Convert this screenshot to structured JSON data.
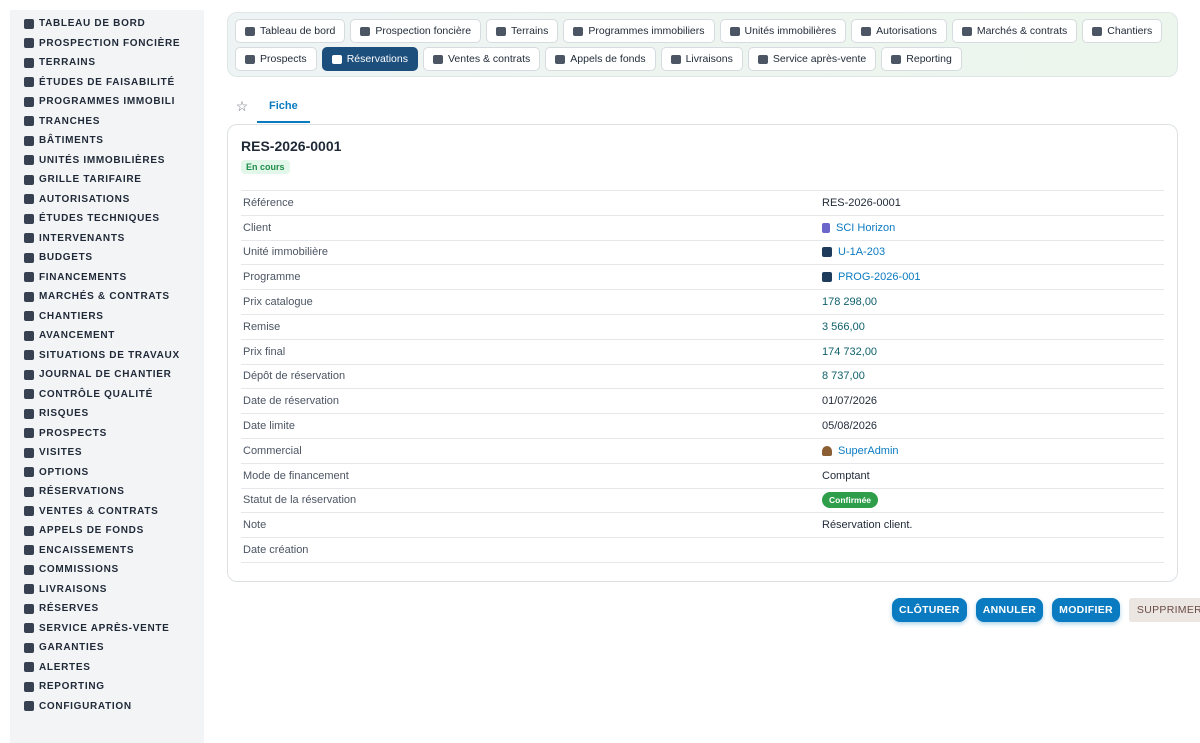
{
  "sidebar": {
    "items": [
      {
        "label": "Tableau de bord",
        "icon": "gauge-icon"
      },
      {
        "label": "Prospection foncière",
        "icon": "binoculars-icon"
      },
      {
        "label": "Terrains",
        "icon": "map-icon"
      },
      {
        "label": "Études de faisabilité",
        "icon": "clipboard-icon"
      },
      {
        "label": "Programmes immobili",
        "icon": "city-icon"
      },
      {
        "label": "Tranches",
        "icon": "layers-icon"
      },
      {
        "label": "Bâtiments",
        "icon": "building-icon"
      },
      {
        "label": "Unités immobilières",
        "icon": "house-icon"
      },
      {
        "label": "Grille tarifaire",
        "icon": "tags-icon"
      },
      {
        "label": "Autorisations",
        "icon": "stamp-icon"
      },
      {
        "label": "Études techniques",
        "icon": "compass-icon"
      },
      {
        "label": "Intervenants",
        "icon": "hardhat-icon"
      },
      {
        "label": "Budgets",
        "icon": "coins-icon"
      },
      {
        "label": "Financements",
        "icon": "bank-icon"
      },
      {
        "label": "Marchés & contrats",
        "icon": "contract-icon"
      },
      {
        "label": "Chantiers",
        "icon": "list-icon"
      },
      {
        "label": "Avancement",
        "icon": "chart-line-icon"
      },
      {
        "label": "Situations de travaux",
        "icon": "file-invoice-icon"
      },
      {
        "label": "Journal de chantier",
        "icon": "book-icon"
      },
      {
        "label": "Contrôle qualité",
        "icon": "check-square-icon"
      },
      {
        "label": "Risques",
        "icon": "warning-icon"
      },
      {
        "label": "Prospects",
        "icon": "user-plus-icon"
      },
      {
        "label": "Visites",
        "icon": "calendar-icon"
      },
      {
        "label": "Options",
        "icon": "hourglass-icon"
      },
      {
        "label": "Réservations",
        "icon": "bookmark-icon"
      },
      {
        "label": "Ventes & contrats",
        "icon": "file-signature-icon"
      },
      {
        "label": "Appels de fonds",
        "icon": "hand-coin-icon"
      },
      {
        "label": "Encaissements",
        "icon": "money-bill-icon"
      },
      {
        "label": "Commissions",
        "icon": "percent-icon"
      },
      {
        "label": "Livraisons",
        "icon": "key-icon"
      },
      {
        "label": "Réserves",
        "icon": "alert-circle-icon"
      },
      {
        "label": "Service après-vente",
        "icon": "tools-icon"
      },
      {
        "label": "Garanties",
        "icon": "shield-icon"
      },
      {
        "label": "Alertes",
        "icon": "bell-icon"
      },
      {
        "label": "Reporting",
        "icon": "pie-chart-icon"
      },
      {
        "label": "Configuration",
        "icon": "gear-icon"
      }
    ]
  },
  "topnav": {
    "row1": [
      {
        "label": "Tableau de bord",
        "icon": "gauge-icon"
      },
      {
        "label": "Prospection foncière",
        "icon": "binoculars-icon"
      },
      {
        "label": "Terrains",
        "icon": "map-icon"
      },
      {
        "label": "Programmes immobiliers",
        "icon": "city-icon"
      },
      {
        "label": "Unités immobilières",
        "icon": "house-icon"
      },
      {
        "label": "Autorisations",
        "icon": "stamp-icon"
      },
      {
        "label": "Marchés & contrats",
        "icon": "contract-icon"
      },
      {
        "label": "Chantiers",
        "icon": "list-icon"
      }
    ],
    "row2": [
      {
        "label": "Prospects",
        "icon": "user-plus-icon"
      },
      {
        "label": "Réservations",
        "icon": "bookmark-icon",
        "active": true
      },
      {
        "label": "Ventes & contrats",
        "icon": "file-signature-icon"
      },
      {
        "label": "Appels de fonds",
        "icon": "hand-coin-icon"
      },
      {
        "label": "Livraisons",
        "icon": "key-icon"
      },
      {
        "label": "Service après-vente",
        "icon": "tools-icon"
      },
      {
        "label": "Reporting",
        "icon": "pie-chart-icon"
      }
    ]
  },
  "tabs": {
    "star_icon": "☆",
    "fiche": "Fiche"
  },
  "record": {
    "title": "RES-2026-0001",
    "status_badge": "En cours",
    "rows": [
      {
        "key": "Référence",
        "value": "RES-2026-0001",
        "kind": "text"
      },
      {
        "key": "Client",
        "value": "SCI Horizon",
        "kind": "link",
        "icon": "building-icon"
      },
      {
        "key": "Unité immobilière",
        "value": "U-1A-203",
        "kind": "link",
        "icon": "unit-icon"
      },
      {
        "key": "Programme",
        "value": "PROG-2026-001",
        "kind": "link",
        "icon": "unit-icon"
      },
      {
        "key": "Prix catalogue",
        "value": "178 298,00",
        "kind": "money"
      },
      {
        "key": "Remise",
        "value": "3 566,00",
        "kind": "money"
      },
      {
        "key": "Prix final",
        "value": "174 732,00",
        "kind": "money"
      },
      {
        "key": "Dépôt de réservation",
        "value": "8 737,00",
        "kind": "money"
      },
      {
        "key": "Date de réservation",
        "value": "01/07/2026",
        "kind": "text"
      },
      {
        "key": "Date limite",
        "value": "05/08/2026",
        "kind": "text"
      },
      {
        "key": "Commercial",
        "value": "SuperAdmin",
        "kind": "link",
        "icon": "user-icon"
      },
      {
        "key": "Mode de financement",
        "value": "Comptant",
        "kind": "text"
      },
      {
        "key": "Statut de la réservation",
        "value": "Confirmée",
        "kind": "pill"
      },
      {
        "key": "Note",
        "value": "Réservation client.",
        "kind": "text"
      },
      {
        "key": "Date création",
        "value": "",
        "kind": "text"
      }
    ]
  },
  "actions": {
    "cloturer": "CLÔTURER",
    "annuler": "ANNULER",
    "modifier": "MODIFIER",
    "supprimer": "SUPPRIMER"
  },
  "colors": {
    "accent": "#0b7bc1",
    "active_nav": "#1d4f7c",
    "status_green": "#2e9e4a"
  }
}
